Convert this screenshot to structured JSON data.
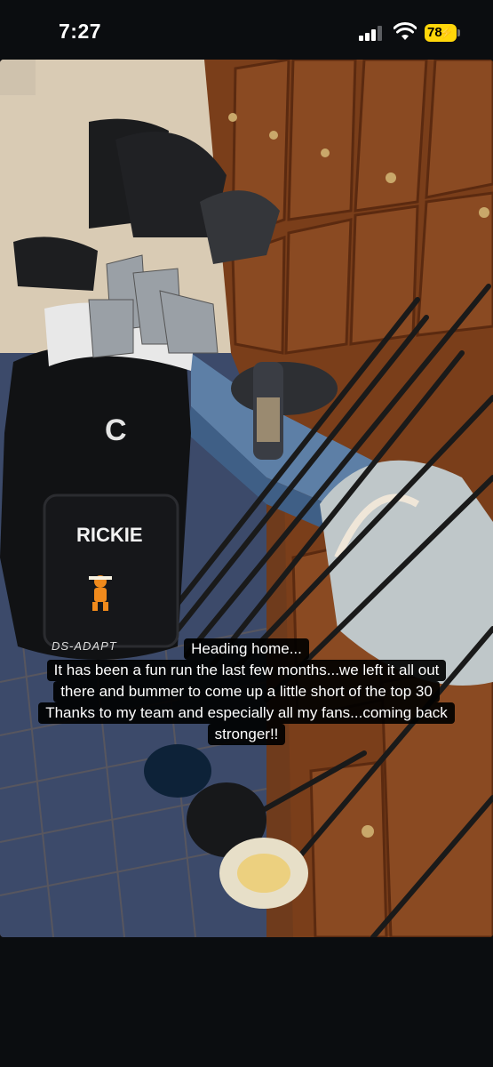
{
  "status_bar": {
    "time": "7:27",
    "battery_level": "78",
    "battery_color": "#ffd60a",
    "signal_bars_active": 3,
    "icons": [
      "signal-icon",
      "wifi-icon",
      "battery-charging-icon"
    ]
  },
  "story": {
    "image_description_icon": "photo",
    "bag_name": "RICKIE",
    "bag_brand_mark": "C",
    "bag_model": "DS-ADAPT",
    "caption_lines": [
      "Heading home...",
      "It has been a fun run the last few months...we left it all out",
      "there and bummer to come up a little short of the top 30",
      "Thanks to my team and especially all my fans...coming back",
      "stronger!!"
    ]
  }
}
